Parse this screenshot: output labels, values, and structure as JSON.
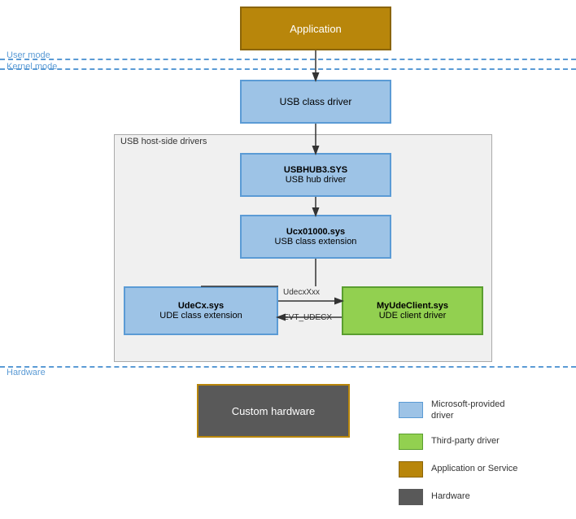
{
  "app": {
    "title": "Application"
  },
  "modes": {
    "user_mode": "User mode",
    "kernel_mode": "Kernel mode"
  },
  "usb_class_driver": {
    "label": "USB class driver"
  },
  "usb_host_container": {
    "label": "USB host-side drivers"
  },
  "usbhub": {
    "title": "USBHUB3.SYS",
    "subtitle": "USB hub driver"
  },
  "ucx": {
    "title": "Ucx01000.sys",
    "subtitle": "USB class extension"
  },
  "udecx": {
    "title": "UdeCx.sys",
    "subtitle": "UDE class extension"
  },
  "myude": {
    "title": "MyUdeClient.sys",
    "subtitle": "UDE client driver"
  },
  "arrows": {
    "top_label": "UdecxXxx",
    "bottom_label": "EVT_UDECX"
  },
  "hardware": {
    "label": "Hardware"
  },
  "custom_hardware": {
    "label": "Custom hardware"
  },
  "legend": {
    "items": [
      {
        "color": "blue",
        "text": "Microsoft-provided driver"
      },
      {
        "color": "green",
        "text": "Third-party driver"
      },
      {
        "color": "gold",
        "text": "Application or Service"
      },
      {
        "color": "dark",
        "text": "Hardware"
      }
    ]
  }
}
